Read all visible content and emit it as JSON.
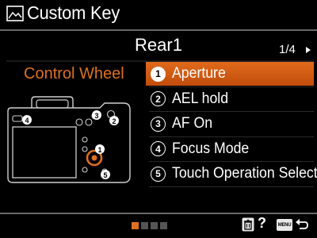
{
  "header": {
    "title": "Custom Key",
    "icon": "custom-key-icon"
  },
  "page": {
    "title": "Rear1",
    "indicator": "1/4",
    "next_arrow": "triangle-right-icon"
  },
  "left_panel": {
    "label": "Control Wheel",
    "camera_callouts": [
      "1",
      "2",
      "3",
      "4",
      "5"
    ]
  },
  "menu": {
    "items": [
      {
        "num": "1",
        "label": "Aperture",
        "selected": true
      },
      {
        "num": "2",
        "label": "AEL hold",
        "selected": false
      },
      {
        "num": "3",
        "label": "AF On",
        "selected": false
      },
      {
        "num": "4",
        "label": "Focus Mode",
        "selected": false
      },
      {
        "num": "5",
        "label": "Touch Operation Select",
        "selected": false
      }
    ]
  },
  "footer": {
    "page_dots": 4,
    "active_dot": 0,
    "help_label": "?",
    "menu_key_label": "MENU"
  },
  "colors": {
    "accent": "#e07020",
    "selected_bg": "#d05a14",
    "rule": "#6a6a6a"
  }
}
